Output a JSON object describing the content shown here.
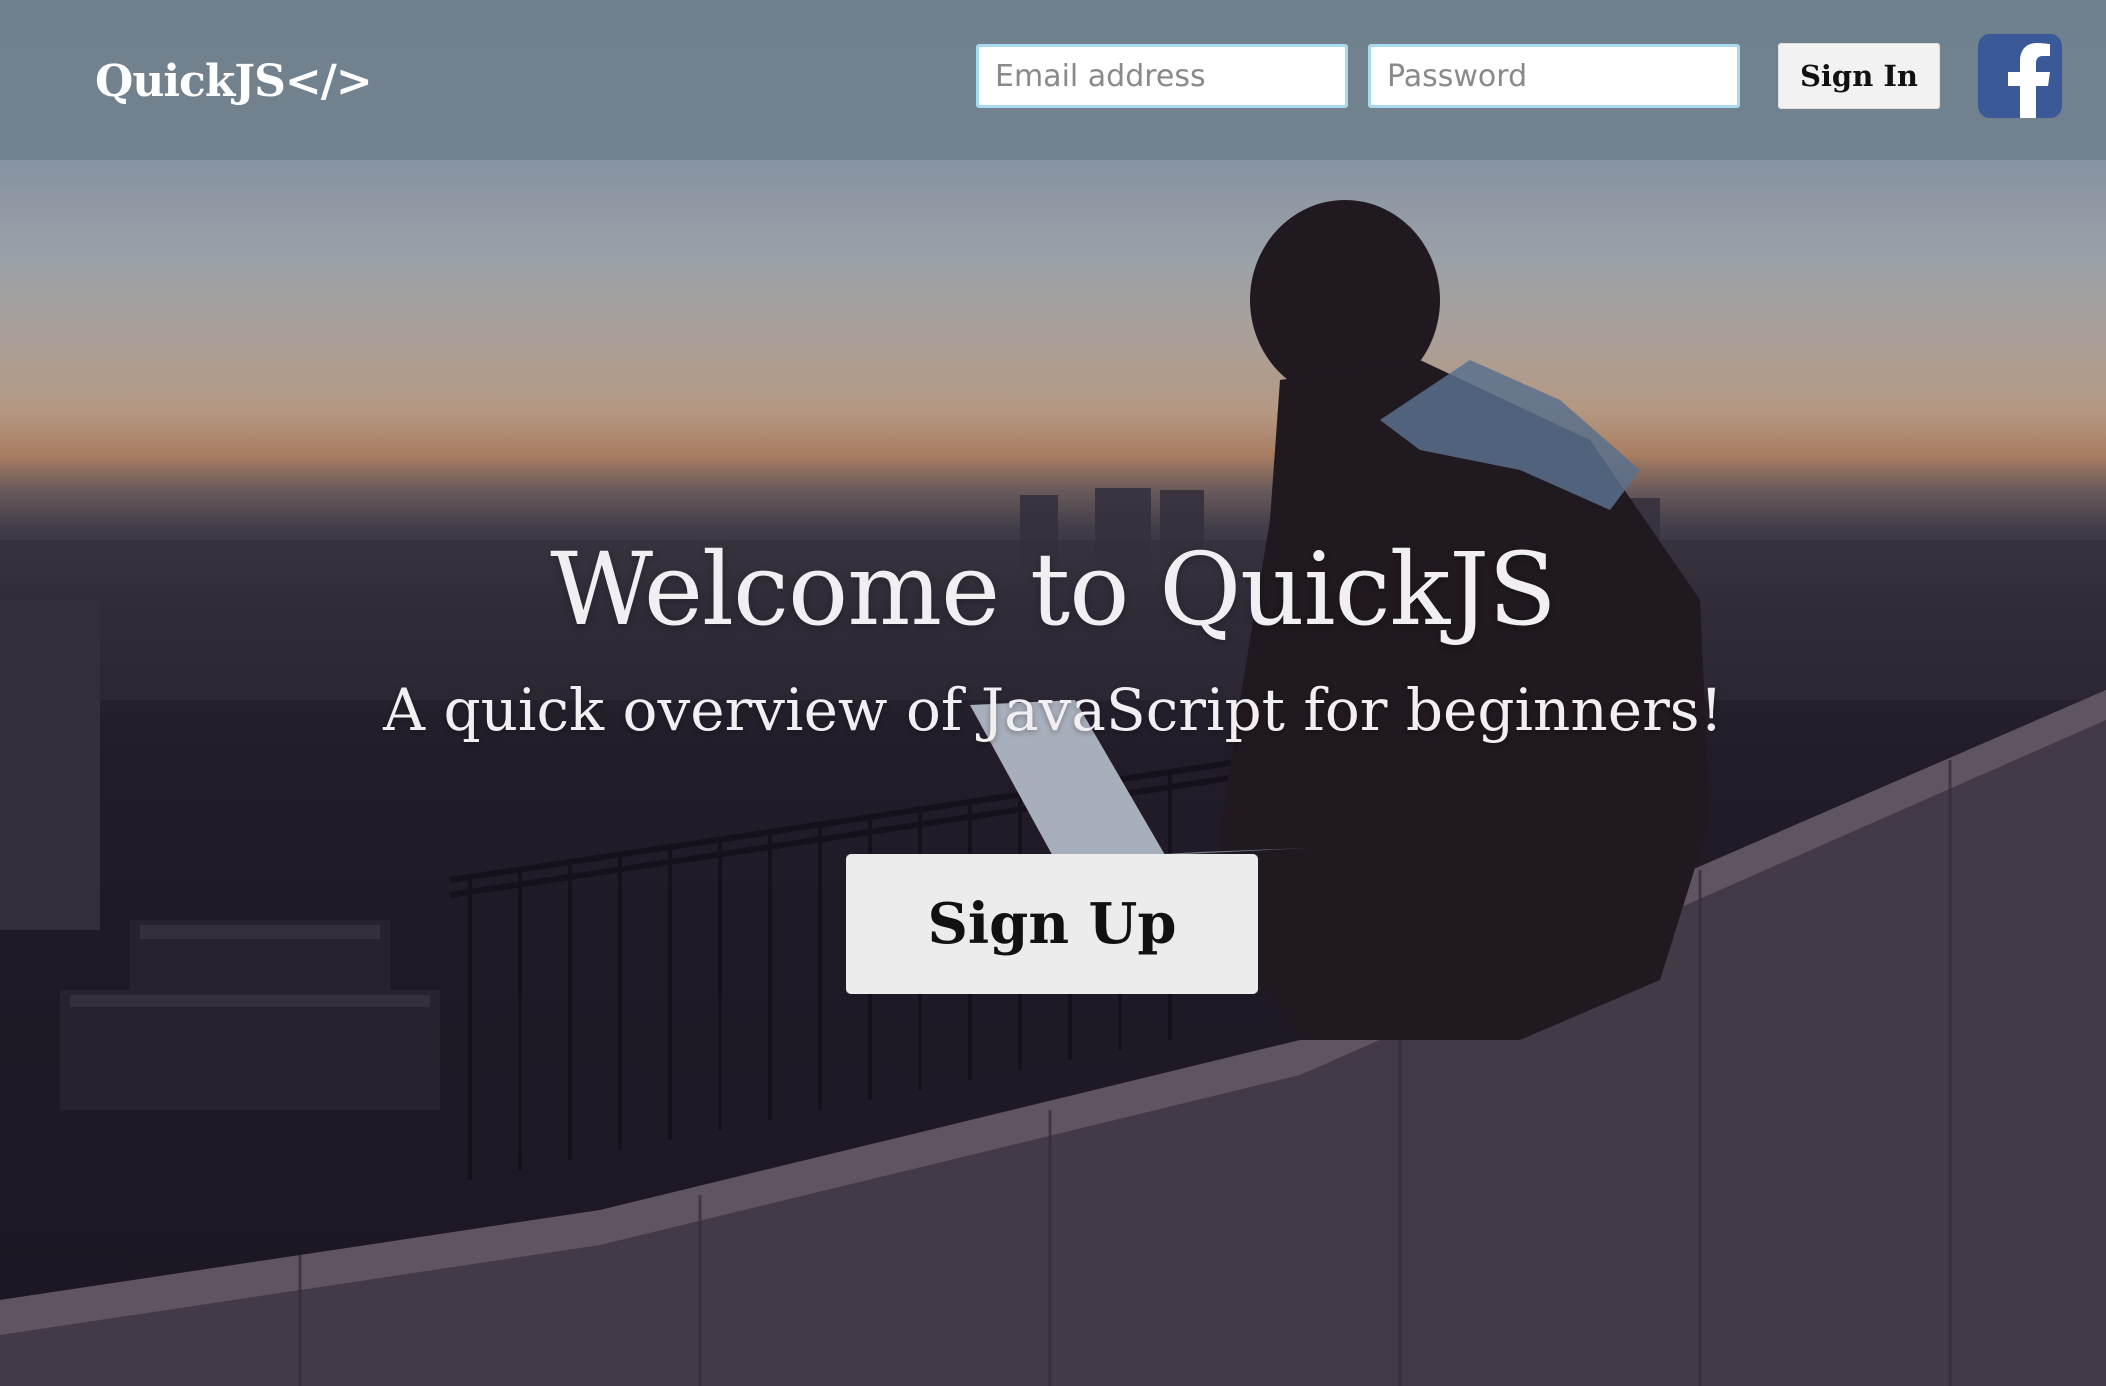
{
  "navbar": {
    "brand": "QuickJS</>",
    "email_placeholder": "Email address",
    "password_placeholder": "Password",
    "signin_label": "Sign In",
    "facebook_icon": "facebook-icon"
  },
  "hero": {
    "title": "Welcome to QuickJS",
    "subtitle": "A quick overview of JavaScript for beginners!",
    "signup_label": "Sign Up",
    "background_image": "person with laptop sitting on wall overlooking city at dusk"
  },
  "colors": {
    "navbar_bg": "#70808d",
    "facebook_blue": "#3b5998",
    "input_border": "#a9d9ef",
    "button_bg": "#ececec",
    "hero_text": "#f2eff2"
  }
}
